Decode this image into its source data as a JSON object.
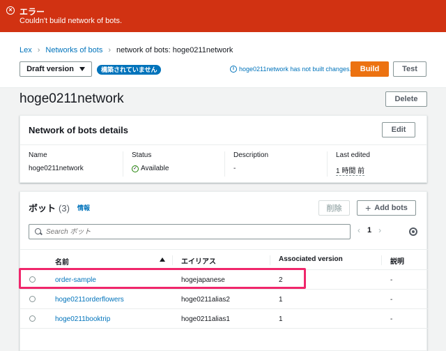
{
  "error": {
    "title": "エラー",
    "message": "Couldn't build network of bots."
  },
  "breadcrumb": {
    "items": [
      "Lex",
      "Networks of bots",
      "network of bots: hoge0211network"
    ]
  },
  "toolbar": {
    "version_select": "Draft version",
    "not_built_badge": "構築されていません",
    "info_note": "hoge0211network has not built changes.",
    "build_label": "Build",
    "test_label": "Test"
  },
  "page": {
    "title": "hoge0211network",
    "delete_label": "Delete"
  },
  "details": {
    "title": "Network of bots details",
    "edit_label": "Edit",
    "fields": [
      {
        "label": "Name",
        "value": "hoge0211network"
      },
      {
        "label": "Status",
        "value": "Available"
      },
      {
        "label": "Description",
        "value": "-"
      },
      {
        "label": "Last edited",
        "value": "1 時間 前"
      }
    ]
  },
  "bots": {
    "title": "ボット",
    "count": "(3)",
    "info_label": "情報",
    "remove_label": "削除",
    "add_label": "Add bots",
    "search_placeholder": "Search ボット",
    "page_number": "1",
    "columns": [
      "名前",
      "エイリアス",
      "Associated version",
      "説明"
    ],
    "rows": [
      {
        "name": "order-sample",
        "alias": "hogejapanese",
        "version": "2",
        "description": "-"
      },
      {
        "name": "hoge0211orderflowers",
        "alias": "hoge0211alias2",
        "version": "1",
        "description": "-"
      },
      {
        "name": "hoge0211booktrip",
        "alias": "hoge0211alias1",
        "version": "1",
        "description": "-"
      }
    ]
  },
  "colors": {
    "error": "#d13212",
    "accent": "#ec7211",
    "link": "#0073bb",
    "success": "#1d8102",
    "highlight": "#f0266b"
  }
}
